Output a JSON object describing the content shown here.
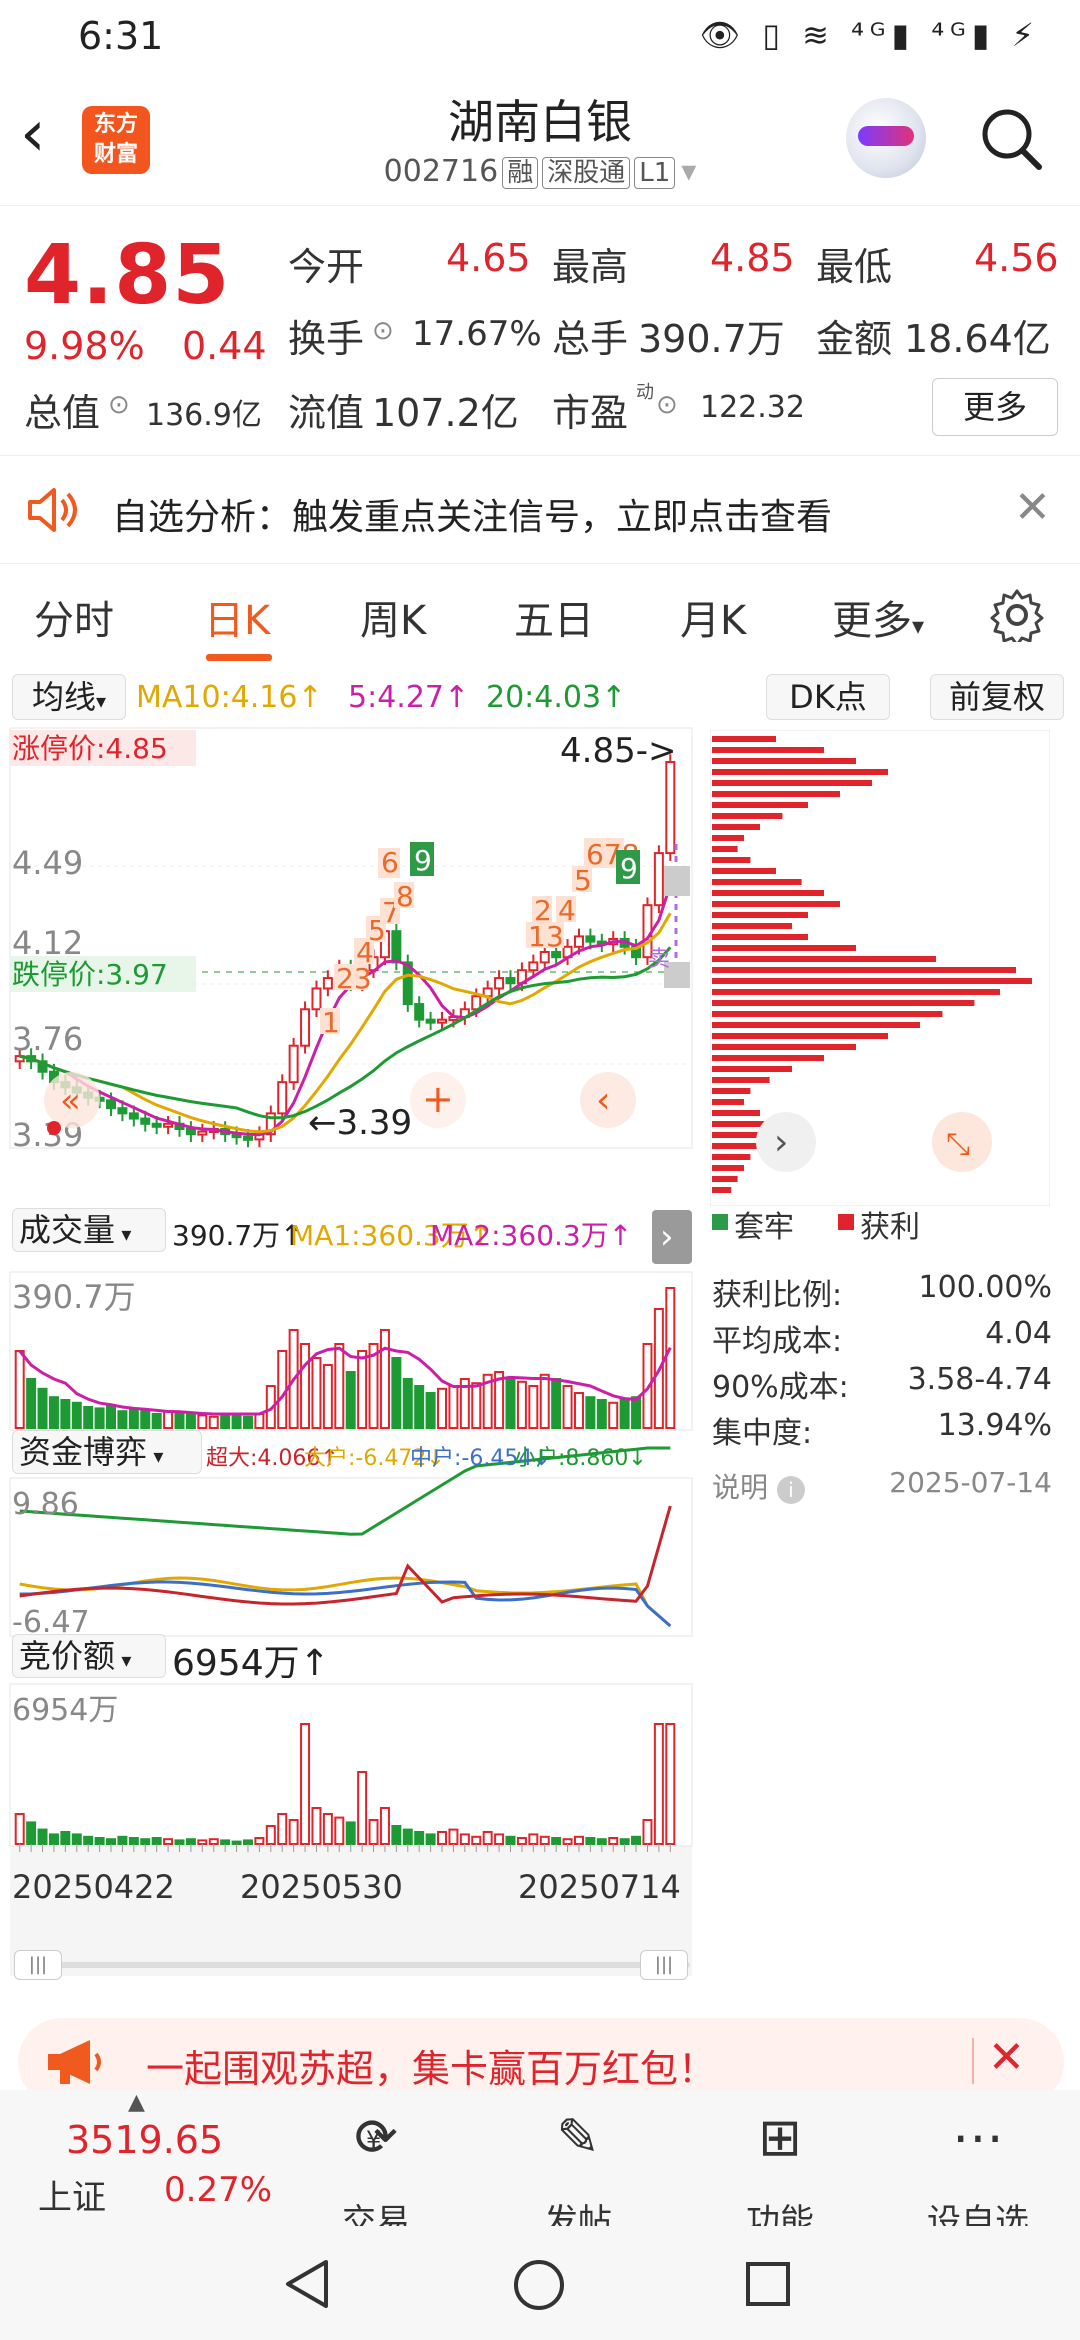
{
  "status": {
    "time": "6:31",
    "icons": "👁 ▯ ≋ ⁴ᴳ▮ ⁴ᴳ▮ ⚡"
  },
  "header": {
    "title": "湖南白银",
    "code": "002716",
    "tag1": "融",
    "tag2": "深股通",
    "tag3": "L1",
    "logo": "东方\n财富"
  },
  "quote": {
    "price": "4.85",
    "pct": "9.98%",
    "change": "0.44",
    "open_label": "今开",
    "open": "4.65",
    "high_label": "最高",
    "high": "4.85",
    "low_label": "最低",
    "low": "4.56",
    "turnover_label": "换手",
    "turnover": "17.67%",
    "volume_label": "总手",
    "volume": "390.7万",
    "amount_label": "金额",
    "amount": "18.64亿",
    "mcap_label": "总值",
    "mcap": "136.9亿",
    "float_label": "流值",
    "float": "107.2亿",
    "pe_label": "市盈",
    "pe_sup": "动",
    "pe": "122.32",
    "more": "更多"
  },
  "notice": {
    "text": "自选分析：触发重点关注信号，立即点击查看"
  },
  "tabs": [
    "分时",
    "日K",
    "周K",
    "五日",
    "月K",
    "更多"
  ],
  "chart": {
    "ma_btn": "均线",
    "ma10": "MA10:4.16↑",
    "ma5": "5:4.27↑",
    "ma20": "20:4.03↑",
    "dk": "DK点",
    "fq": "前复权",
    "limit_up": "涨停价:4.85",
    "limit_down": "跌停价:3.97",
    "ytick1": "4.49",
    "ytick2": "4.12",
    "ytick3": "3.76",
    "ytick4": "3.39",
    "last_arrow": "4.85->",
    "low_arrow": "←3.39",
    "vol_btn": "成交量",
    "vol_val": "390.7万↑",
    "vol_ma1": "MA1:360.3万↑",
    "vol_ma2": "MA2:360.3万↑",
    "vol_max": "390.7万",
    "fund_btn": "资金博弈",
    "fund_super": "超大:4.066↑",
    "fund_big": "大户:-6.472↓",
    "fund_mid": "中户:-6.454↓",
    "fund_small": "小户:8.860↓",
    "fund_max": "9.86",
    "fund_min": "-6.47",
    "bid_btn": "竞价额",
    "bid_val": "6954万↑",
    "bid_max": "6954万",
    "dates": [
      "20250422",
      "20250530",
      "20250714"
    ]
  },
  "chips": {
    "legend_trap": "套牢",
    "legend_profit": "获利",
    "rows": [
      {
        "k": "获利比例:",
        "v": "100.00%"
      },
      {
        "k": "平均成本:",
        "v": "4.04"
      },
      {
        "k": "90%成本:",
        "v": "3.58-4.74"
      },
      {
        "k": "集中度:",
        "v": "13.94%"
      }
    ],
    "note": "说明",
    "date": "2025-07-14"
  },
  "banner": {
    "text": "一起围观苏超，集卡赢百万红包！"
  },
  "bottom": {
    "index_value": "3519.65",
    "index_name": "上证",
    "index_pct": "0.27%",
    "nav": [
      "交易",
      "发帖",
      "功能",
      "设自选"
    ]
  },
  "colors": {
    "up": "#e0242b",
    "down": "#1e9a34",
    "accent": "#f05a1e",
    "ma10": "#e2a800",
    "ma5": "#cc1fa8",
    "ma20": "#1e9a34"
  }
}
